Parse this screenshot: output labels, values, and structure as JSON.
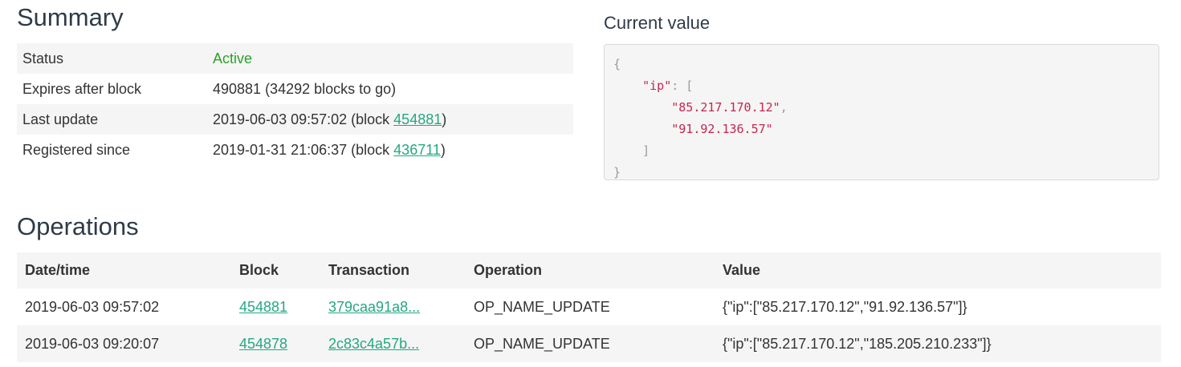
{
  "summary": {
    "title": "Summary",
    "rows": [
      {
        "label": "Status",
        "value": "Active"
      },
      {
        "label": "Expires after block",
        "value": "490881 (34292 blocks to go)"
      },
      {
        "label": "Last update",
        "prefix": "2019-06-03 09:57:02 (block ",
        "link": "454881",
        "suffix": ")"
      },
      {
        "label": "Registered since",
        "prefix": "2019-01-31 21:06:37 (block ",
        "link": "436711",
        "suffix": ")"
      }
    ]
  },
  "current_value": {
    "title": "Current value",
    "lines": {
      "l1": "{",
      "l2_indent": "    ",
      "l2_key": "\"ip\"",
      "l2_rest": ": [",
      "l3_indent": "        ",
      "l3_val": "\"85.217.170.12\"",
      "l3_comma": ",",
      "l4_indent": "        ",
      "l4_val": "\"91.92.136.57\"",
      "l5": "    ]",
      "l6": "}"
    }
  },
  "operations": {
    "title": "Operations",
    "headers": {
      "datetime": "Date/time",
      "block": "Block",
      "transaction": "Transaction",
      "operation": "Operation",
      "value": "Value"
    },
    "rows": [
      {
        "datetime": "2019-06-03 09:57:02",
        "block": "454881",
        "transaction": "379caa91a8...",
        "operation": "OP_NAME_UPDATE",
        "value": "{\"ip\":[\"85.217.170.12\",\"91.92.136.57\"]}"
      },
      {
        "datetime": "2019-06-03 09:20:07",
        "block": "454878",
        "transaction": "2c83c4a57b...",
        "operation": "OP_NAME_UPDATE",
        "value": "{\"ip\":[\"85.217.170.12\",\"185.205.210.233\"]}"
      }
    ]
  },
  "colors": {
    "link": "#25a882",
    "active": "#28a228",
    "json_string": "#c7254e",
    "row_shade": "#f5f5f5"
  }
}
